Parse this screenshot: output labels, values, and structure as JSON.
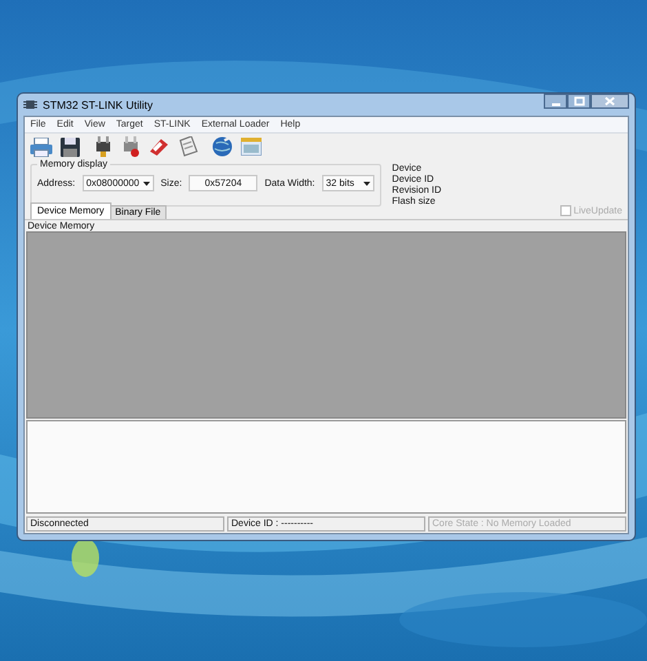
{
  "window": {
    "title": "STM32 ST-LINK Utility"
  },
  "menu": [
    "File",
    "Edit",
    "View",
    "Target",
    "ST-LINK",
    "External Loader",
    "Help"
  ],
  "memory_display": {
    "title": "Memory display",
    "address_label": "Address:",
    "address": "0x08000000",
    "size_label": "Size:",
    "size": "0x57204",
    "width_label": "Data Width:",
    "width": "32 bits"
  },
  "device_info": [
    "Device",
    "Device ID",
    "Revision ID",
    "Flash size"
  ],
  "tabs": [
    {
      "label": "Device Memory",
      "selected": true
    },
    {
      "label": "Binary File",
      "selected": false
    }
  ],
  "live_update": {
    "label": "LiveUpdate",
    "checked": false,
    "disabled": true
  },
  "panel_label": "Device Memory",
  "status_bar": [
    {
      "text": "Disconnected",
      "disabled": false
    },
    {
      "text": "Device ID : ----------",
      "disabled": false
    },
    {
      "text": "Core State : No Memory Loaded",
      "disabled": true
    }
  ]
}
